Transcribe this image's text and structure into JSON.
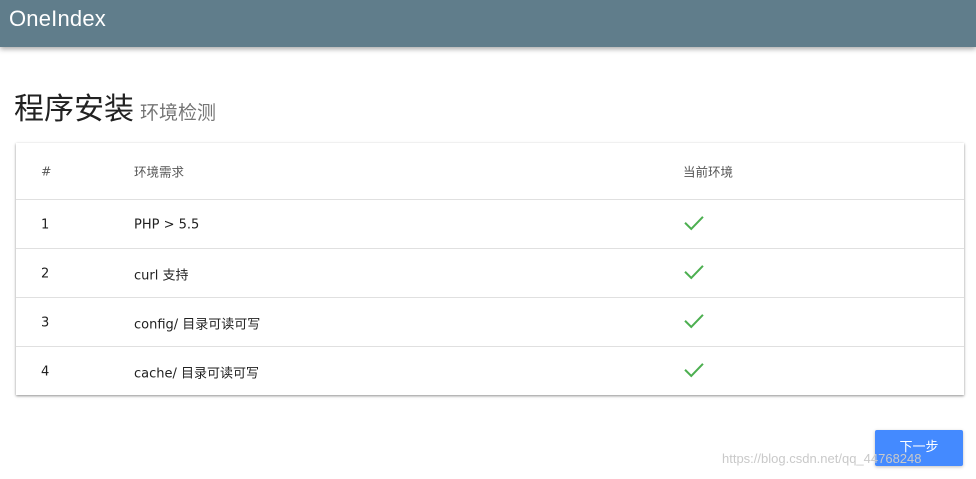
{
  "appbar": {
    "title": "OneIndex"
  },
  "heading": {
    "main": "程序安装",
    "sub": "环境检测"
  },
  "table": {
    "headers": [
      "#",
      "环境需求",
      "当前环境"
    ],
    "rows": [
      {
        "num": "1",
        "requirement": "PHP > 5.5",
        "status_icon": "check-icon"
      },
      {
        "num": "2",
        "requirement": "curl 支持",
        "status_icon": "check-icon"
      },
      {
        "num": "3",
        "requirement": "config/ 目录可读可写",
        "status_icon": "check-icon"
      },
      {
        "num": "4",
        "requirement": "cache/ 目录可读可写",
        "status_icon": "check-icon"
      }
    ]
  },
  "actions": {
    "next_label": "下一步"
  },
  "watermark": "https://blog.csdn.net/qq_44768248",
  "colors": {
    "appbar": "#607d8b",
    "check": "#4caf50",
    "button": "#448aff"
  }
}
